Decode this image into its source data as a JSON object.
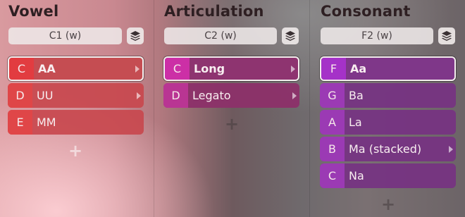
{
  "columns": [
    {
      "title": "Vowel",
      "selector": "C1 (w)",
      "layers_icon": "layers-icon",
      "add_icon": "+",
      "rows": [
        {
          "key": "C",
          "label": "AA",
          "selected": true,
          "has_submenu": true
        },
        {
          "key": "D",
          "label": "UU",
          "selected": false,
          "has_submenu": true
        },
        {
          "key": "E",
          "label": "MM",
          "selected": false,
          "has_submenu": false
        }
      ]
    },
    {
      "title": "Articulation",
      "selector": "C2 (w)",
      "layers_icon": "layers-icon",
      "add_icon": "+",
      "rows": [
        {
          "key": "C",
          "label": "Long",
          "selected": true,
          "has_submenu": true
        },
        {
          "key": "D",
          "label": "Legato",
          "selected": false,
          "has_submenu": true
        }
      ]
    },
    {
      "title": "Consonant",
      "selector": "F2 (w)",
      "layers_icon": "layers-icon",
      "add_icon": "+",
      "rows": [
        {
          "key": "F",
          "label": "Aa",
          "selected": true,
          "has_submenu": false
        },
        {
          "key": "G",
          "label": "Ba",
          "selected": false,
          "has_submenu": false
        },
        {
          "key": "A",
          "label": "La",
          "selected": false,
          "has_submenu": false
        },
        {
          "key": "B",
          "label": "Ma (stacked)",
          "selected": false,
          "has_submenu": true
        },
        {
          "key": "C",
          "label": "Na",
          "selected": false,
          "has_submenu": false
        }
      ]
    }
  ],
  "colors": {
    "vowel_accent": "#e23c40",
    "articulation_accent": "#cc2fa6",
    "consonant_accent": "#a532c8"
  }
}
